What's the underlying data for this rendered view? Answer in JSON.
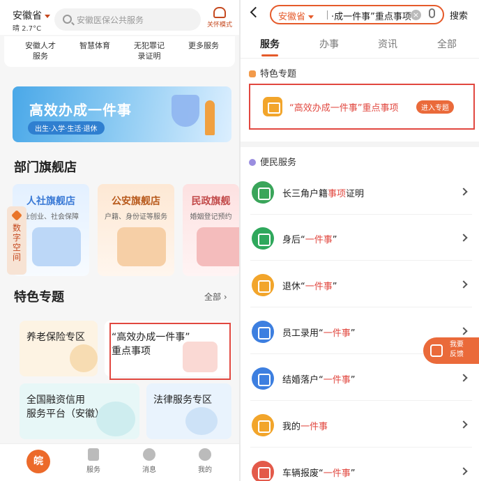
{
  "left": {
    "header": {
      "location": "安徽省",
      "weather": "晴 2.7°C",
      "search_placeholder": "安徽医保公共服务",
      "care_mode": "关怀模式"
    },
    "quick_items": [
      {
        "label_1": "安徽人才",
        "label_2": "服务"
      },
      {
        "label_1": "智慧体育",
        "label_2": ""
      },
      {
        "label_1": "无犯罪记",
        "label_2": "录证明"
      },
      {
        "label_1": "更多服务",
        "label_2": ""
      }
    ],
    "banner": {
      "title": "高效办成一件事",
      "subtitle": "出生·入学·生活·退休"
    },
    "dept_section": {
      "title": "部门旗舰店"
    },
    "stores": [
      {
        "name": "人社旗舰店",
        "sub": "业创业、社会保障"
      },
      {
        "name": "公安旗舰店",
        "sub": "户籍、身份证等服务"
      },
      {
        "name": "民政旗舰",
        "sub": "婚姻登记预约"
      }
    ],
    "side_tab": {
      "line1": "数",
      "line2": "字",
      "line3": "空",
      "line4": "间"
    },
    "topics_section": {
      "title": "特色专题",
      "more": "全部"
    },
    "topics": [
      {
        "title_1": "养老保险专区",
        "title_2": ""
      },
      {
        "title_1": "“高效办成一件事”",
        "title_2": "重点事项"
      },
      {
        "title_1": "全国融资信用",
        "title_2": "服务平台（安徽）"
      },
      {
        "title_1": "法律服务专区",
        "title_2": ""
      }
    ],
    "tabbar": {
      "home": "皖",
      "services": "服务",
      "messages": "消息",
      "mine": "我的"
    }
  },
  "right": {
    "header": {
      "location": "安徽省",
      "query": "·成一件事”重点事项",
      "search_button": "搜索"
    },
    "tabs": [
      "服务",
      "办事",
      "资讯",
      "全部"
    ],
    "featured_section": {
      "title": "特色专题"
    },
    "featured_item": {
      "text": "“高效办成一件事”重点事项",
      "enter": "进入专题"
    },
    "convenience_section": {
      "title": "便民服务"
    },
    "services": [
      {
        "prefix": "长三角户籍",
        "highlight": "事项",
        "suffix": "证明",
        "color": "#3aa55a"
      },
      {
        "prefix": "身后“",
        "highlight": "一件事",
        "suffix": "”",
        "color": "#2fa85c"
      },
      {
        "prefix": "退休“",
        "highlight": "一件事",
        "suffix": "”",
        "color": "#f2a52b"
      },
      {
        "prefix": "员工录用“",
        "highlight": "一件事",
        "suffix": "”",
        "color": "#3d7fe0"
      },
      {
        "prefix": "结婚落户“",
        "highlight": "一件事",
        "suffix": "”",
        "color": "#3d7fe0"
      },
      {
        "prefix": "我的",
        "highlight": "一件事",
        "suffix": "",
        "color": "#f2a52b"
      },
      {
        "prefix": "车辆报废“",
        "highlight": "一件事",
        "suffix": "”",
        "color": "#e35a4a"
      }
    ],
    "feedback": {
      "label": "我要反馈"
    }
  },
  "colors": {
    "accent": "#e55a2a",
    "highlight": "#e1473f"
  }
}
